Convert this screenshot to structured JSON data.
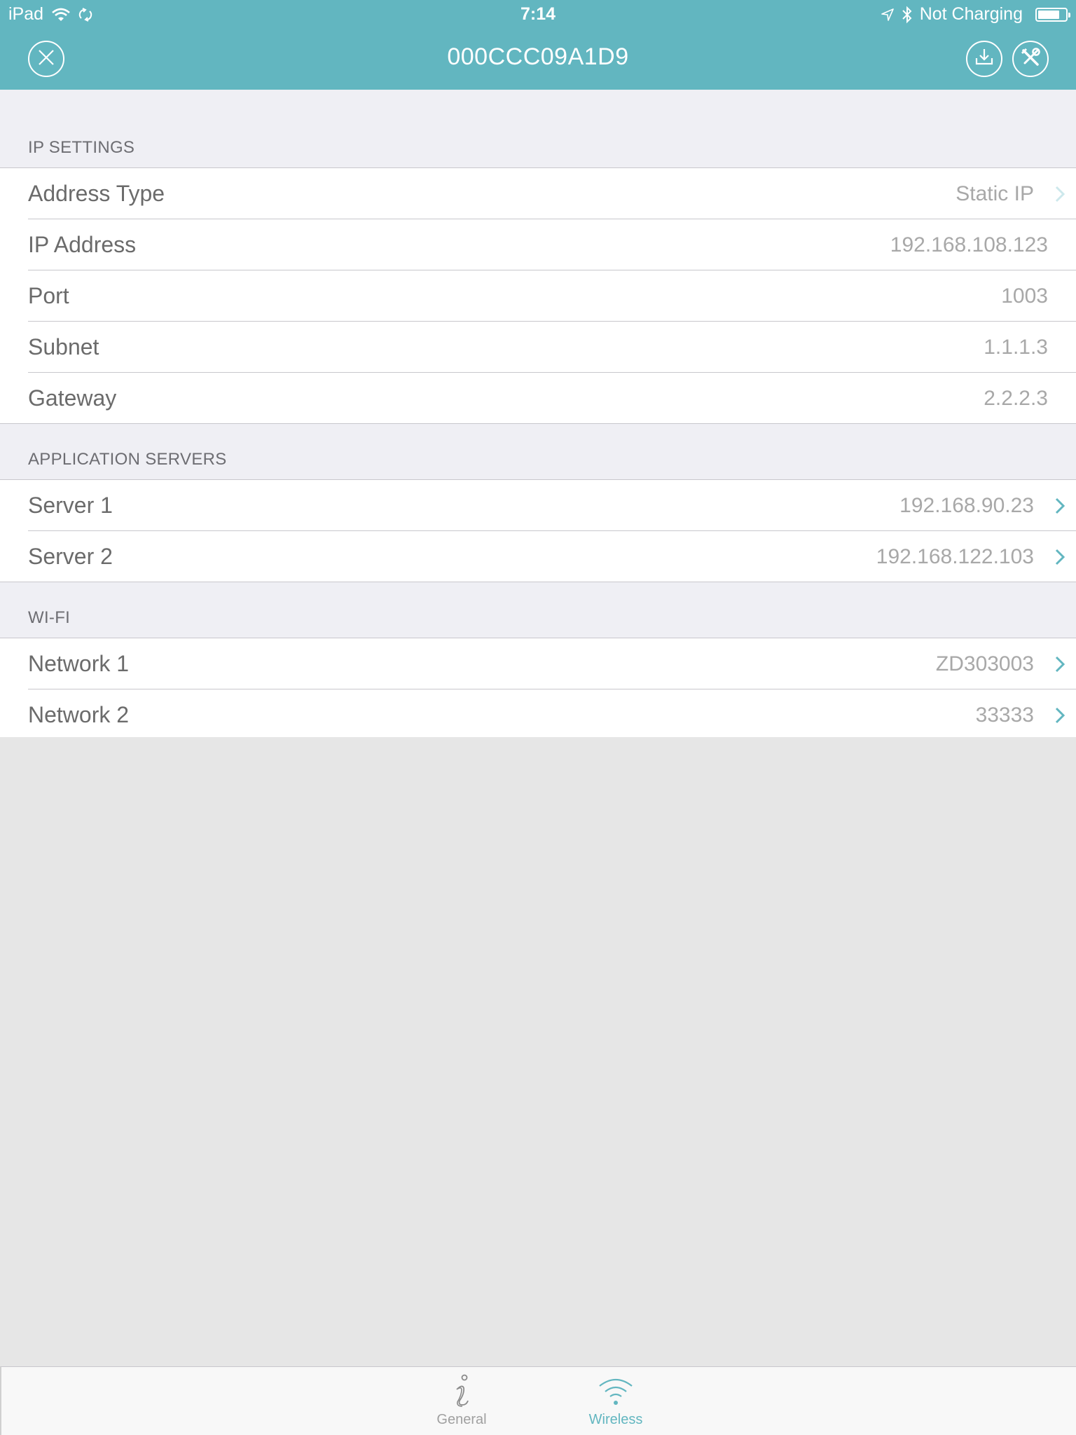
{
  "status_bar": {
    "device": "iPad",
    "time": "7:14",
    "charging": "Not Charging",
    "battery_level": 0.8,
    "icons": [
      "wifi-icon",
      "sync-icon",
      "location-icon",
      "bluetooth-icon",
      "battery-icon"
    ]
  },
  "navbar": {
    "title": "000CCC09A1D9",
    "left_button": "close-icon",
    "right_buttons": [
      "download-icon",
      "tools-icon"
    ]
  },
  "colors": {
    "accent": "#62b6c0",
    "header_bg": "#efeff4",
    "label": "#6b6b6b",
    "value": "#a8a8a8"
  },
  "sections": [
    {
      "title": "IP SETTINGS",
      "rows": [
        {
          "label": "Address Type",
          "value": "Static IP",
          "chevron": "disabled"
        },
        {
          "label": "IP Address",
          "value": "192.168.108.123",
          "chevron": "none"
        },
        {
          "label": "Port",
          "value": "1003",
          "chevron": "none"
        },
        {
          "label": "Subnet",
          "value": "1.1.1.3",
          "chevron": "none"
        },
        {
          "label": "Gateway",
          "value": "2.2.2.3",
          "chevron": "none"
        }
      ]
    },
    {
      "title": "APPLICATION SERVERS",
      "rows": [
        {
          "label": "Server 1",
          "value": "192.168.90.23",
          "chevron": "active"
        },
        {
          "label": "Server 2",
          "value": "192.168.122.103",
          "chevron": "active"
        }
      ]
    },
    {
      "title": "WI-FI",
      "rows": [
        {
          "label": "Network 1",
          "value": "ZD303003",
          "chevron": "active"
        },
        {
          "label": "Network 2",
          "value": "33333",
          "chevron": "active"
        }
      ]
    }
  ],
  "tabbar": {
    "tabs": [
      {
        "label": "General",
        "icon": "info-icon",
        "selected": false
      },
      {
        "label": "Wireless",
        "icon": "wifi-icon",
        "selected": true
      }
    ]
  }
}
